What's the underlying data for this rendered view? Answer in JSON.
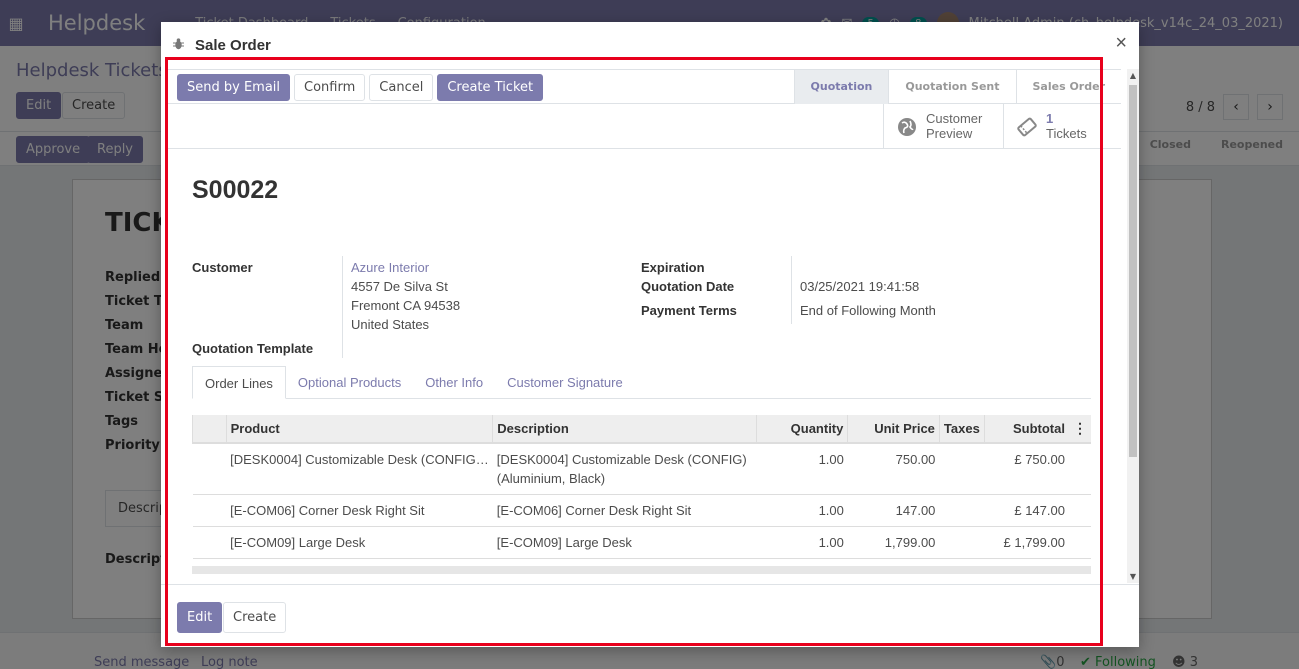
{
  "app": {
    "brand": "Helpdesk",
    "menu": [
      "Ticket Dashboard",
      "Tickets",
      "Configuration"
    ],
    "messages_count": "5",
    "activities_count": "8",
    "user": "Mitchell Admin (ch_helpdesk_v14c_24_03_2021)"
  },
  "background": {
    "breadcrumb": "Helpdesk Tickets /",
    "edit": "Edit",
    "create": "Create",
    "pager": "8 / 8",
    "approve": "Approve",
    "reply": "Reply",
    "stages": [
      "Closed",
      "Reopened"
    ],
    "sheet_title": "TICK",
    "labels": [
      "Replied S",
      "Ticket Ty",
      "Team",
      "Team Hea",
      "Assigned",
      "Ticket Su",
      "Tags",
      "Priority"
    ],
    "desc_tab": "Descrip",
    "desc_label": "Descripti",
    "send_message": "Send message",
    "log_note": "Log note",
    "attachments": "0",
    "following": "Following",
    "followers": "3"
  },
  "modal": {
    "title": "Sale Order",
    "close": "×",
    "header_buttons": {
      "send_email": "Send by Email",
      "confirm": "Confirm",
      "cancel": "Cancel",
      "create_ticket": "Create Ticket"
    },
    "statusbar": [
      "Quotation",
      "Quotation Sent",
      "Sales Order"
    ],
    "smart": {
      "preview_line1": "Customer",
      "preview_line2": "Preview",
      "tickets_count": "1",
      "tickets_label": "Tickets"
    },
    "name": "S00022",
    "fields": {
      "customer_label": "Customer",
      "customer_name": "Azure Interior",
      "address1": "4557 De Silva St",
      "address2": "Fremont CA 94538",
      "address3": "United States",
      "template_label": "Quotation Template",
      "expiration_label": "Expiration",
      "quotation_date_label": "Quotation Date",
      "quotation_date": "03/25/2021 19:41:58",
      "payment_terms_label": "Payment Terms",
      "payment_terms": "End of Following Month"
    },
    "tabs": [
      "Order Lines",
      "Optional Products",
      "Other Info",
      "Customer Signature"
    ],
    "columns": {
      "product": "Product",
      "description": "Description",
      "quantity": "Quantity",
      "unit_price": "Unit Price",
      "taxes": "Taxes",
      "subtotal": "Subtotal"
    },
    "lines": [
      {
        "product": "[DESK0004] Customizable Desk (CONFIG) (Aluminium, Black)",
        "product_short": "[DESK0004] Customizable Desk (CONFIG…",
        "desc1": "[DESK0004] Customizable Desk (CONFIG)",
        "desc2": "(Aluminium, Black)",
        "qty": "1.00",
        "price": "750.00",
        "taxes": "",
        "subtotal": "£ 750.00"
      },
      {
        "product_short": "[E-COM06] Corner Desk Right Sit",
        "desc1": "[E-COM06] Corner Desk Right Sit",
        "desc2": "",
        "qty": "1.00",
        "price": "147.00",
        "taxes": "",
        "subtotal": "£ 147.00"
      },
      {
        "product_short": "[E-COM09] Large Desk",
        "desc1": "[E-COM09] Large Desk",
        "desc2": "",
        "qty": "1.00",
        "price": "1,799.00",
        "taxes": "",
        "subtotal": "£ 1,799.00"
      }
    ],
    "footer": {
      "edit": "Edit",
      "create": "Create"
    }
  },
  "colors": {
    "brand": "#7c7bad",
    "highlight_frame": "#e8001c"
  }
}
